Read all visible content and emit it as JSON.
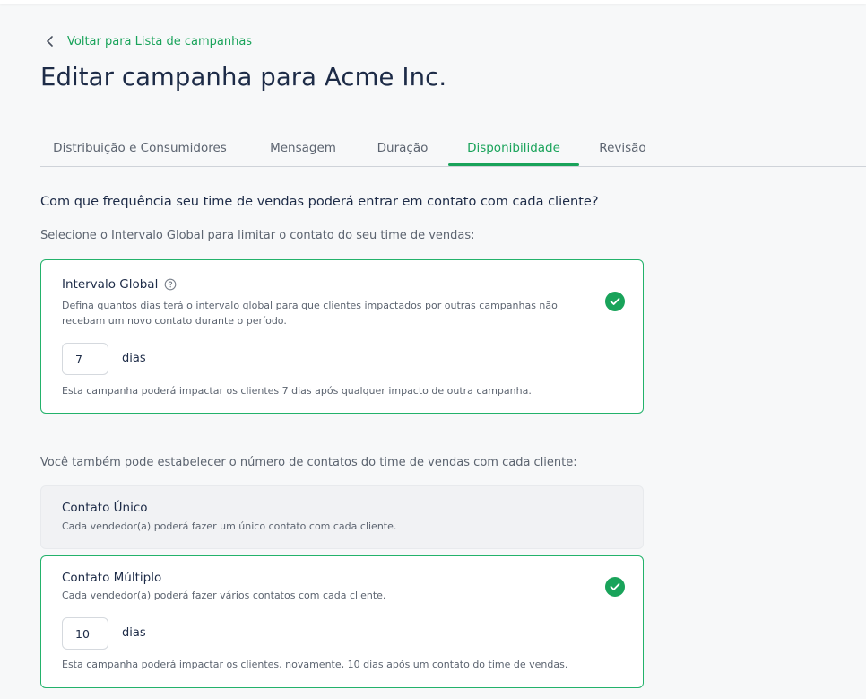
{
  "back_link": {
    "label": "Voltar para Lista de campanhas"
  },
  "page_title": "Editar campanha para Acme Inc.",
  "tabs": [
    {
      "label": "Distribuição e Consumidores",
      "active": false
    },
    {
      "label": "Mensagem",
      "active": false
    },
    {
      "label": "Duração",
      "active": false
    },
    {
      "label": "Disponibilidade",
      "active": true
    },
    {
      "label": "Revisão",
      "active": false
    }
  ],
  "question": "Com que frequência seu time de vendas poderá entrar em contato com cada cliente?",
  "global_prompt": "Selecione o Intervalo Global para limitar o contato do seu time de vendas:",
  "global_interval": {
    "title": "Intervalo Global",
    "help_icon": "question-circle-icon",
    "description": "Defina quantos dias terá o intervalo global para que clientes impactados por outras campanhas não recebam um novo contato durante o período.",
    "value": "7",
    "unit": "dias",
    "footnote": "Esta campanha poderá impactar os clientes 7 dias após qualquer impacto de outra campanha.",
    "selected": true
  },
  "contacts_prompt": "Você também pode estabelecer o número de contatos do time de vendas com cada cliente:",
  "single_contact": {
    "title": "Contato Único",
    "description": "Cada vendedor(a) poderá fazer um único contato com cada cliente.",
    "selected": false
  },
  "multiple_contact": {
    "title": "Contato Múltiplo",
    "description": "Cada vendedor(a) poderá fazer vários contatos com cada cliente.",
    "value": "10",
    "unit": "dias",
    "footnote": "Esta campanha poderá impactar os clientes, novamente, 10 dias após um contato do time de vendas.",
    "selected": true
  },
  "colors": {
    "accent": "#19a35a",
    "title": "#1d2b47",
    "muted_text": "#5c6470",
    "background": "#f7f8f9"
  }
}
